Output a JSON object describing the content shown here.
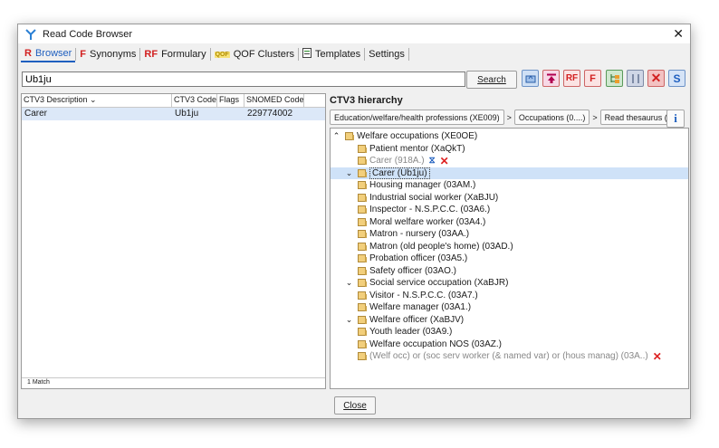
{
  "window": {
    "title": "Read Code Browser"
  },
  "tabs": [
    {
      "label": "Browser",
      "icon": "R",
      "icon_color": "#d22020"
    },
    {
      "label": "Synonyms",
      "icon": "F",
      "icon_color": "#d22020"
    },
    {
      "label": "Formulary",
      "icon": "RF",
      "icon_color": "#d22020"
    },
    {
      "label": "QOF Clusters",
      "icon": "QOF",
      "icon_color": "#c8a000"
    },
    {
      "label": "Templates",
      "icon": "tpl",
      "icon_color": "#444444"
    },
    {
      "label": "Settings",
      "icon": "",
      "icon_color": ""
    }
  ],
  "search": {
    "value": "Ub1ju",
    "button": "Search"
  },
  "results": {
    "columns": [
      "CTV3 Description",
      "CTV3 Code",
      "Flags",
      "SNOMED Code"
    ],
    "rows": [
      {
        "description": "Carer",
        "code": "Ub1ju",
        "flags": "",
        "snomed": "229774002"
      }
    ],
    "status": "1 Match"
  },
  "hierarchy": {
    "title": "CTV3 hierarchy",
    "breadcrumbs": [
      "Education/welfare/health professions (XE009)",
      "Occupations (0....)",
      "Read thesaurus (.."
    ],
    "nodes": [
      {
        "label": "Welfare occupations (XE0OE)",
        "toggle": "^",
        "grey": false,
        "selected": false,
        "mark": ""
      },
      {
        "label": "Patient mentor (XaQkT)",
        "toggle": "",
        "grey": false,
        "selected": false,
        "mark": ""
      },
      {
        "label": "Carer (918A.)",
        "toggle": "",
        "grey": true,
        "selected": false,
        "mark": "sx"
      },
      {
        "label": "Carer (Ub1ju)",
        "toggle": "v",
        "grey": false,
        "selected": true,
        "mark": ""
      },
      {
        "label": "Housing manager (03AM.)",
        "toggle": "",
        "grey": false,
        "selected": false,
        "mark": ""
      },
      {
        "label": "Industrial social worker (XaBJU)",
        "toggle": "",
        "grey": false,
        "selected": false,
        "mark": ""
      },
      {
        "label": "Inspector - N.S.P.C.C. (03A6.)",
        "toggle": "",
        "grey": false,
        "selected": false,
        "mark": ""
      },
      {
        "label": "Moral welfare worker (03A4.)",
        "toggle": "",
        "grey": false,
        "selected": false,
        "mark": ""
      },
      {
        "label": "Matron - nursery (03AA.)",
        "toggle": "",
        "grey": false,
        "selected": false,
        "mark": ""
      },
      {
        "label": "Matron (old people's home) (03AD.)",
        "toggle": "",
        "grey": false,
        "selected": false,
        "mark": ""
      },
      {
        "label": "Probation officer (03A5.)",
        "toggle": "",
        "grey": false,
        "selected": false,
        "mark": ""
      },
      {
        "label": "Safety officer (03AO.)",
        "toggle": "",
        "grey": false,
        "selected": false,
        "mark": ""
      },
      {
        "label": "Social service occupation (XaBJR)",
        "toggle": "v",
        "grey": false,
        "selected": false,
        "mark": ""
      },
      {
        "label": "Visitor - N.S.P.C.C. (03A7.)",
        "toggle": "",
        "grey": false,
        "selected": false,
        "mark": ""
      },
      {
        "label": "Welfare manager (03A1.)",
        "toggle": "",
        "grey": false,
        "selected": false,
        "mark": ""
      },
      {
        "label": "Welfare officer (XaBJV)",
        "toggle": "v",
        "grey": false,
        "selected": false,
        "mark": ""
      },
      {
        "label": "Youth leader (03A9.)",
        "toggle": "",
        "grey": false,
        "selected": false,
        "mark": ""
      },
      {
        "label": "Welfare occupation NOS (03AZ.)",
        "toggle": "",
        "grey": false,
        "selected": false,
        "mark": ""
      },
      {
        "label": "(Welf occ) or (soc serv worker (& named var) or (hous manag) (03A..)",
        "toggle": "",
        "grey": true,
        "selected": false,
        "mark": "x"
      }
    ]
  },
  "footer": {
    "close": "Close"
  },
  "colors": {
    "accent": "#1f5fbf",
    "selection": "#cfe2f8",
    "delete_red": "#d22020"
  }
}
